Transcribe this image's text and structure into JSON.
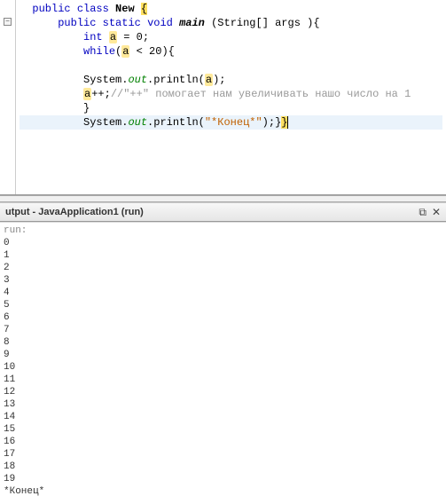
{
  "editor": {
    "lines": [
      {
        "indent": "  ",
        "tokens": [
          {
            "t": "public ",
            "c": "kw"
          },
          {
            "t": "class ",
            "c": "kw"
          },
          {
            "t": "New ",
            "c": "bold"
          },
          {
            "t": "{",
            "c": "brace-hl"
          }
        ]
      },
      {
        "indent": "      ",
        "tokens": [
          {
            "t": "public ",
            "c": "kw"
          },
          {
            "t": "static ",
            "c": "kw"
          },
          {
            "t": "void ",
            "c": "kw"
          },
          {
            "t": "main ",
            "c": "bold ital-m"
          },
          {
            "t": "(String[] args ){",
            "c": ""
          }
        ]
      },
      {
        "indent": "          ",
        "tokens": [
          {
            "t": "int ",
            "c": "kw"
          },
          {
            "t": "a",
            "c": "var-hl"
          },
          {
            "t": " = 0;",
            "c": ""
          }
        ]
      },
      {
        "indent": "          ",
        "tokens": [
          {
            "t": "while",
            "c": "kw"
          },
          {
            "t": "(",
            "c": ""
          },
          {
            "t": "a",
            "c": "var-hl"
          },
          {
            "t": " < 20){",
            "c": ""
          }
        ]
      },
      {
        "indent": "",
        "tokens": []
      },
      {
        "indent": "          ",
        "tokens": [
          {
            "t": "System.",
            "c": ""
          },
          {
            "t": "out",
            "c": "ital"
          },
          {
            "t": ".println(",
            "c": ""
          },
          {
            "t": "a",
            "c": "var-hl"
          },
          {
            "t": ");",
            "c": ""
          }
        ]
      },
      {
        "indent": "          ",
        "tokens": [
          {
            "t": "a",
            "c": "var-hl"
          },
          {
            "t": "++;",
            "c": ""
          },
          {
            "t": "//\"++\" помогает нам увеличивать нашо число на 1",
            "c": "cmt"
          }
        ]
      },
      {
        "indent": "          ",
        "tokens": [
          {
            "t": "}",
            "c": ""
          }
        ]
      },
      {
        "indent": "          ",
        "tokens": [
          {
            "t": "System.",
            "c": ""
          },
          {
            "t": "out",
            "c": "ital"
          },
          {
            "t": ".println(",
            "c": ""
          },
          {
            "t": "\"*Конец*\"",
            "c": "str"
          },
          {
            "t": ");}",
            "c": ""
          },
          {
            "t": "}",
            "c": "brace-hl"
          }
        ],
        "active": true,
        "cursor": true
      }
    ]
  },
  "outputPanel": {
    "title": "utput - JavaApplication1 (run)",
    "runLabel": "run:",
    "lines": [
      "0",
      "1",
      "2",
      "3",
      "4",
      "5",
      "6",
      "7",
      "8",
      "9",
      "10",
      "11",
      "12",
      "13",
      "14",
      "15",
      "16",
      "17",
      "18",
      "19",
      "*Конец*"
    ]
  }
}
